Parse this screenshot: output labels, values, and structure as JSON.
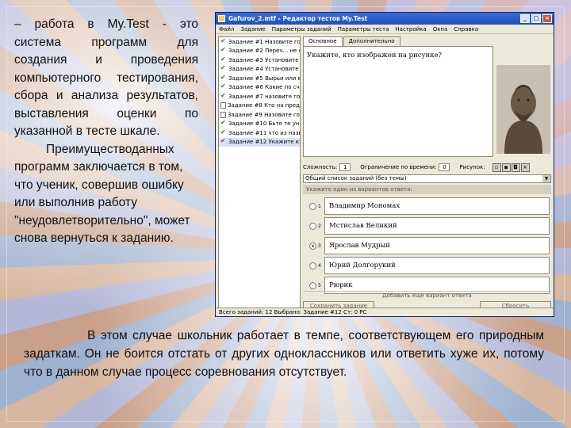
{
  "slide": {
    "left_text": "– работа в My.Test - это система программ для создания и проведения компьютерного тестирования, сбора и анализа результатов, выставления оценки по указанной в тесте шкале.",
    "left_text_2": "Преимуществоданных программ заключается в том, что ученик, совершив ошибку или выполнив работу \"неудовлетворительно\", может снова вернуться к заданию.",
    "bottom_text": "В этом случае школьник работает в темпе, соответствующем его природным задаткам. Он не боится отстать от других одноклассников или ответить хуже их, потому что в данном случае процесс соревнования отсутствует."
  },
  "window": {
    "title": "Gafurov_2.mtf - Редактор тестов My.Test",
    "menu": [
      "Файл",
      "Задание",
      "Параметры заданий",
      "Параметры теста",
      "Настройка",
      "Окна",
      "Справка"
    ],
    "tasks": [
      {
        "label": "Задание #1 Назовите год к",
        "status": "check"
      },
      {
        "label": "Задание #2 Переч... не ет",
        "status": "check"
      },
      {
        "label": "Задание #3 Установите по",
        "status": "check"
      },
      {
        "label": "Задание #4 Установите по",
        "status": "check"
      },
      {
        "label": "Задание #5 Вырьи или вед",
        "status": "check"
      },
      {
        "label": "Задание #6 Какие по счет",
        "status": "check"
      },
      {
        "label": "Задание #7 назовите годы",
        "status": "check"
      },
      {
        "label": "Задание #8 Кто на предо",
        "status": "doc"
      },
      {
        "label": "Задание #9 Назовите год",
        "status": "doc"
      },
      {
        "label": "Задание #10 Бьте те уни",
        "status": "check"
      },
      {
        "label": "Задание #11 что из назва",
        "status": "check"
      },
      {
        "label": "Задание #12 Укажите кто",
        "status": "check-red"
      }
    ],
    "tabs": [
      "Основное",
      "Дополнительно"
    ],
    "question": "Укажите, кто изображен на рисунке?",
    "difficulty_label": "Сложность:",
    "difficulty_value": "1",
    "time_label": "Ограничение по времени:",
    "time_value": "0",
    "picture_label": "Рисунок:",
    "combo_value": "Общий список заданий (без темы)",
    "answers_header": "Укажите один из вариантов ответа:",
    "answers": [
      {
        "num": "1",
        "text": "Владимир Мономах",
        "selected": false
      },
      {
        "num": "2",
        "text": "Мстислав Великий",
        "selected": false
      },
      {
        "num": "3",
        "text": "Ярослав Мудрый",
        "selected": true
      },
      {
        "num": "4",
        "text": "Юрий Долгорукий",
        "selected": false
      },
      {
        "num": "5",
        "text": "Рюрик",
        "selected": false
      }
    ],
    "add_answer": "Добавить еще вариант ответа",
    "save_button": "Сохранить задание",
    "reset_button": "Сбросить",
    "status": "Всего заданий: 12   Выбрано: Задание #12   Ст: 0   РС"
  }
}
